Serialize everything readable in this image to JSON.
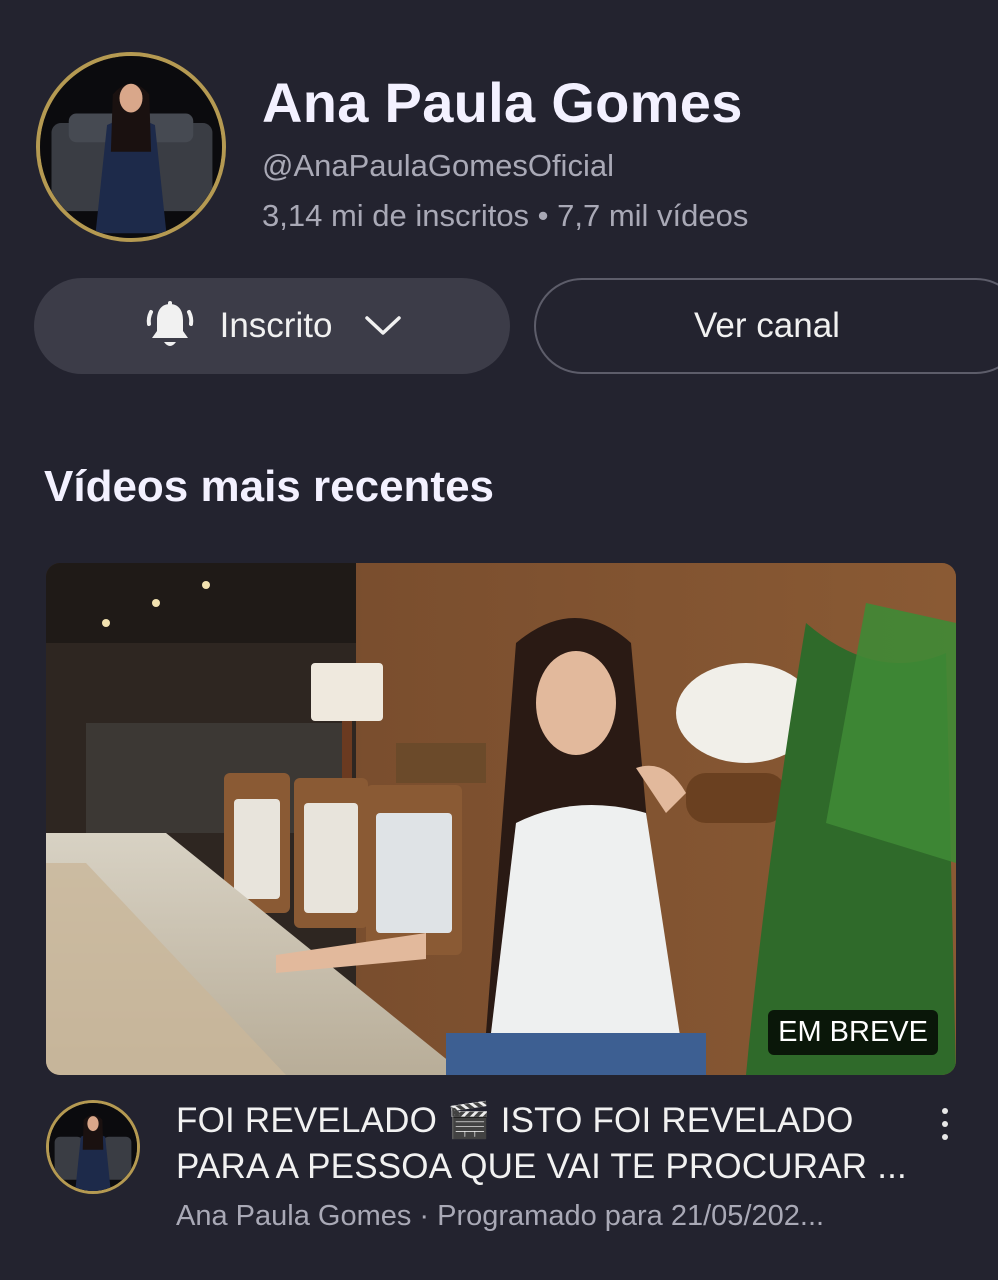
{
  "channel": {
    "name": "Ana Paula Gomes",
    "handle": "@AnaPaulaGomesOficial",
    "stats": "3,14 mi de inscritos • 7,7 mil vídeos"
  },
  "actions": {
    "subscribed_label": "Inscrito",
    "view_channel_label": "Ver canal"
  },
  "section": {
    "title": "Vídeos mais recentes"
  },
  "video": {
    "badge": "EM BREVE",
    "title_line1": "FOI REVELADO 🎬 ISTO FOI REVELADO",
    "title_line2": "PARA A PESSOA QUE VAI TE PROCURAR ...",
    "subtitle": "Ana Paula Gomes · Programado para 21/05/202..."
  },
  "icons": [
    "bell-icon",
    "chevron-down-icon",
    "more-vert-icon"
  ],
  "colors": {
    "background": "#23232f",
    "button": "#3c3c48",
    "avatar_ring": "#b59a52",
    "secondary_text": "#a9a9b6"
  }
}
